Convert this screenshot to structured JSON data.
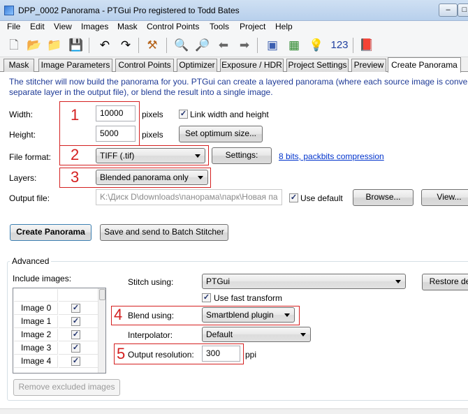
{
  "window": {
    "title": "DPP_0002 Panorama - PTGui Pro registered to Todd Bates",
    "minimize": "–",
    "maximize": "□"
  },
  "menu": [
    "File",
    "Edit",
    "View",
    "Images",
    "Mask",
    "Control Points",
    "Tools",
    "Project",
    "Help"
  ],
  "toolbar": {
    "counter": "123"
  },
  "tabs": [
    "Mask",
    "Image Parameters",
    "Control Points",
    "Optimizer",
    "Exposure / HDR",
    "Project Settings",
    "Preview",
    "Create Panorama"
  ],
  "create": {
    "intro_line1": "The stitcher will now build the panorama for you. PTGui can create a layered panorama (where each source image is converte",
    "intro_line2": "separate layer in the output file), or blend the result into a single image.",
    "width_label": "Width:",
    "width_value": "10000",
    "height_label": "Height:",
    "height_value": "5000",
    "pixels_unit": "pixels",
    "link_label": "Link width and height",
    "link_checked": true,
    "optimum_button": "Set optimum size...",
    "file_format_label": "File format:",
    "file_format_value": "TIFF (.tif)",
    "settings_button": "Settings:",
    "settings_link": "8 bits, packbits compression",
    "layers_label": "Layers:",
    "layers_value": "Blended panorama only",
    "output_file_label": "Output file:",
    "output_file_value": "K:\\Диск D\\downloads\\панорама\\парк\\Новая па",
    "use_default_label": "Use default",
    "use_default_checked": true,
    "browse_button": "Browse...",
    "view_button": "View...",
    "create_button": "Create Panorama",
    "batch_button": "Save and send to Batch Stitcher"
  },
  "advanced": {
    "group_label": "Advanced",
    "include_images_label": "Include images:",
    "images": [
      {
        "name": "Image 0",
        "checked": true
      },
      {
        "name": "Image 1",
        "checked": true
      },
      {
        "name": "Image 2",
        "checked": true
      },
      {
        "name": "Image 3",
        "checked": true
      },
      {
        "name": "Image 4",
        "checked": true
      }
    ],
    "remove_excluded_button": "Remove excluded images",
    "stitch_using_label": "Stitch using:",
    "stitch_using_value": "PTGui",
    "restore_button": "Restore de",
    "fast_transform_label": "Use fast transform",
    "fast_transform_checked": true,
    "blend_using_label": "Blend using:",
    "blend_using_value": "Smartblend plugin",
    "interpolator_label": "Interpolator:",
    "interpolator_value": "Default",
    "output_resolution_label": "Output resolution:",
    "output_resolution_value": "300",
    "ppi_unit": "ppi"
  },
  "annotations": [
    "1",
    "2",
    "3",
    "4",
    "5"
  ],
  "colors": {
    "annotation_red": "#d42020",
    "intro_text": "#1e3a96",
    "link": "#0033cc"
  }
}
